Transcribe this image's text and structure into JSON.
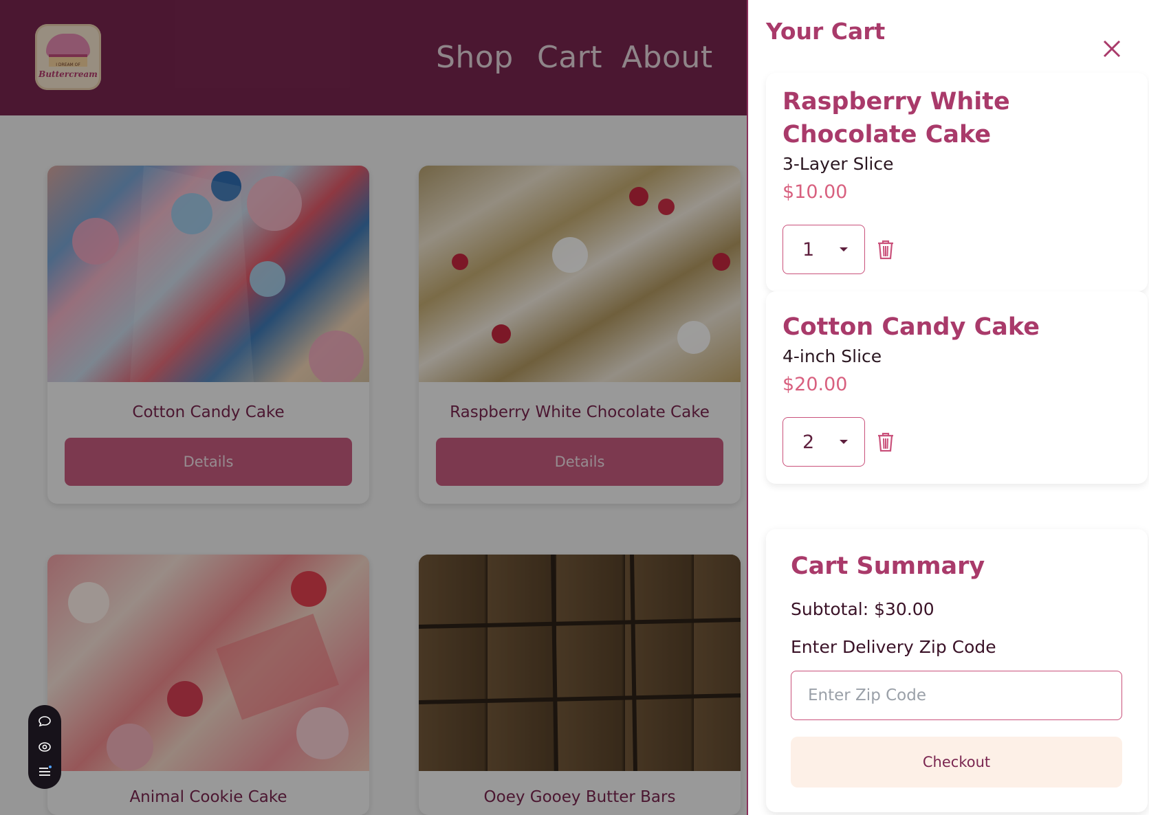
{
  "header": {
    "logo": {
      "small_text": "I DREAM OF",
      "brand_text": "Buttercream"
    },
    "nav": [
      {
        "label": "Shop"
      },
      {
        "label": "Cart"
      },
      {
        "label": "About"
      }
    ]
  },
  "products": [
    {
      "name": "Cotton Candy Cake",
      "button": "Details"
    },
    {
      "name": "Raspberry White Chocolate Cake",
      "button": "Details"
    },
    {
      "name": "Animal Cookie Cake"
    },
    {
      "name": "Ooey Gooey Butter Bars"
    }
  ],
  "cart": {
    "title": "Your Cart",
    "items": [
      {
        "name": "Raspberry White Chocolate Cake",
        "variant": "3-Layer Slice",
        "price": "$10.00",
        "quantity": "1"
      },
      {
        "name": "Cotton Candy Cake",
        "variant": "4-inch Slice",
        "price": "$20.00",
        "quantity": "2"
      }
    ],
    "summary": {
      "title": "Cart Summary",
      "subtotal": "Subtotal: $30.00",
      "zip_label": "Enter Delivery Zip Code",
      "zip_placeholder": "Enter Zip Code",
      "checkout_label": "Checkout"
    }
  },
  "colors": {
    "header_bg": "#7a2650",
    "accent": "#a93a6a",
    "button": "#c95d80",
    "price": "#d8607f",
    "checkout_bg": "#fdf0e7"
  },
  "icons": {
    "close": "close-icon",
    "trash": "trash-icon",
    "chat": "chat-icon",
    "eye": "eye-icon",
    "menu": "menu-icon"
  }
}
